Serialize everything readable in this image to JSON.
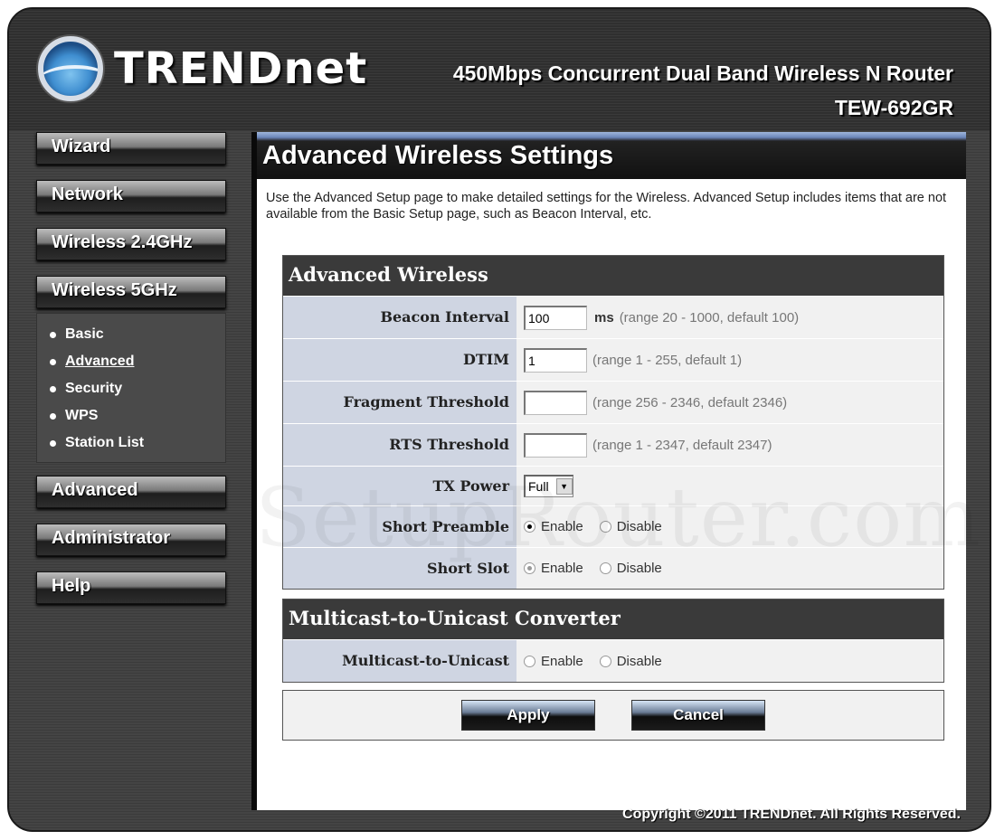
{
  "header": {
    "brand": "TRENDnet",
    "product_line": "450Mbps Concurrent Dual Band Wireless N Router",
    "model": "TEW-692GR"
  },
  "nav": {
    "items": [
      {
        "label": "Wizard"
      },
      {
        "label": "Network"
      },
      {
        "label": "Wireless 2.4GHz"
      },
      {
        "label": "Wireless 5GHz"
      },
      {
        "label": "Advanced"
      },
      {
        "label": "Administrator"
      },
      {
        "label": "Help"
      }
    ],
    "subitems": [
      {
        "label": "Basic",
        "active": false
      },
      {
        "label": "Advanced",
        "active": true
      },
      {
        "label": "Security",
        "active": false
      },
      {
        "label": "WPS",
        "active": false
      },
      {
        "label": "Station List",
        "active": false
      }
    ]
  },
  "page": {
    "title": "Advanced Wireless Settings",
    "intro": "Use the Advanced Setup page to make detailed settings for the Wireless. Advanced Setup includes items that are not available from the Basic Setup page, such as Beacon Interval, etc."
  },
  "advanced_wireless": {
    "heading": "Advanced Wireless",
    "beacon_interval": {
      "label": "Beacon Interval",
      "value": "100",
      "unit": "ms",
      "hint": "(range 20 - 1000, default 100)"
    },
    "dtim": {
      "label": "DTIM",
      "value": "1",
      "hint": "(range 1 - 255, default 1)"
    },
    "fragment_threshold": {
      "label": "Fragment Threshold",
      "value": "",
      "hint": "(range 256 - 2346, default 2346)"
    },
    "rts_threshold": {
      "label": "RTS Threshold",
      "value": "",
      "hint": "(range 1 - 2347, default 2347)"
    },
    "tx_power": {
      "label": "TX Power",
      "selected": "Full"
    },
    "short_preamble": {
      "label": "Short Preamble",
      "enable": "Enable",
      "disable": "Disable",
      "selected": "Enable"
    },
    "short_slot": {
      "label": "Short Slot",
      "enable": "Enable",
      "disable": "Disable",
      "selected": "Enable",
      "disabled": true
    }
  },
  "multicast": {
    "heading": "Multicast-to-Unicast Converter",
    "label": "Multicast-to-Unicast",
    "enable": "Enable",
    "disable": "Disable",
    "selected": null
  },
  "actions": {
    "apply": "Apply",
    "cancel": "Cancel"
  },
  "footer": {
    "copyright": "Copyright ©2011 TRENDnet. All Rights Reserved."
  },
  "watermark": "SetupRouter.com"
}
